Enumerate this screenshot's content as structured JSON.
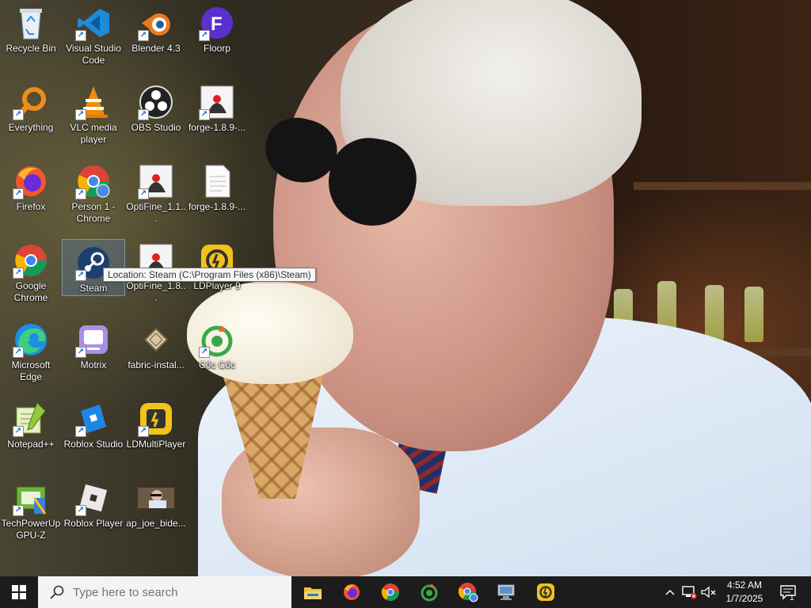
{
  "desktop": {
    "icons": [
      {
        "label": "Recycle Bin",
        "icon": "recycle-bin-icon"
      },
      {
        "label": "Visual Studio Code",
        "icon": "vscode-icon"
      },
      {
        "label": "Blender 4.3",
        "icon": "blender-icon"
      },
      {
        "label": "Floorp",
        "icon": "floorp-icon"
      },
      {
        "label": "Everything",
        "icon": "everything-search-icon"
      },
      {
        "label": "VLC media player",
        "icon": "vlc-icon"
      },
      {
        "label": "OBS Studio",
        "icon": "obs-icon"
      },
      {
        "label": "forge-1.8.9-...",
        "icon": "java-icon"
      },
      {
        "label": "Firefox",
        "icon": "firefox-icon"
      },
      {
        "label": "Person 1 - Chrome",
        "icon": "chrome-profile-icon"
      },
      {
        "label": "OptiFine_1.1...",
        "icon": "java-icon"
      },
      {
        "label": "forge-1.8.9-...",
        "icon": "document-icon"
      },
      {
        "label": "Google Chrome",
        "icon": "chrome-icon"
      },
      {
        "label": "Steam",
        "icon": "steam-icon"
      },
      {
        "label": "OptiFine_1.8...",
        "icon": "java-icon"
      },
      {
        "label": "LDPlayer 9",
        "icon": "ldplayer-icon"
      },
      {
        "label": "Microsoft Edge",
        "icon": "edge-icon"
      },
      {
        "label": "Motrix",
        "icon": "motrix-icon"
      },
      {
        "label": "fabric-instal...",
        "icon": "jar-icon"
      },
      {
        "label": "Cốc Cốc",
        "icon": "coccoc-icon"
      },
      {
        "label": "Notepad++",
        "icon": "notepadpp-icon"
      },
      {
        "label": "Roblox Studio",
        "icon": "roblox-studio-icon"
      },
      {
        "label": "LDMultiPlayer",
        "icon": "ldmultiplayer-icon"
      },
      {
        "label": "TechPowerUp GPU-Z",
        "icon": "gpuz-icon"
      },
      {
        "label": "Roblox Player",
        "icon": "roblox-icon"
      },
      {
        "label": "ap_joe_bide...",
        "icon": "image-thumbnail-icon"
      }
    ],
    "tooltip": "Location: Steam (C:\\Program Files (x86)\\Steam)"
  },
  "taskbar": {
    "search_placeholder": "Type here to search",
    "apps": [
      "file-explorer-icon",
      "firefox-icon",
      "chrome-icon",
      "coccoc-icon",
      "chrome-profile-icon",
      "network-pc-icon",
      "ldplayer-icon"
    ],
    "clock": {
      "time": "4:52 AM",
      "date": "1/7/2025"
    },
    "notification_count": "1"
  }
}
